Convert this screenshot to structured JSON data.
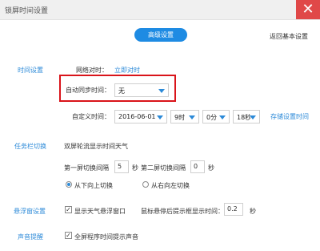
{
  "window": {
    "title": "锁屏时间设置",
    "close_label": "✕"
  },
  "header": {
    "advanced_button": "高级设置",
    "back_link": "返回基本设置"
  },
  "time_settings": {
    "section_label": "时间设置",
    "network_sync_label": "网络对时：",
    "sync_now_link": "立即对时",
    "auto_sync_label": "自动同步时间：",
    "auto_sync_value": "无",
    "custom_time_label": "自定义时间：",
    "date_value": "2016-06-01",
    "hour_value": "9时",
    "minute_value": "0分",
    "second_value": "18秒",
    "apply_link": "存储设置时间"
  },
  "task_switch": {
    "section_label": "任务栏切换",
    "mode_label": "双屏轮流显示时间天气",
    "first_screen_label": "第一屏切换间隔",
    "first_screen_value": "5",
    "seconds_label": "秒",
    "second_screen_label": "第二屏切换间隔",
    "second_screen_value": "0",
    "seconds_label2": "秒",
    "option_bottom": "从下向上切换",
    "option_right": "从右向左切换"
  },
  "float_settings": {
    "section_label": "悬浮窗设置",
    "show_weather_label": "显示天气悬浮窗口",
    "hide_delay_label": "鼠标悬停后提示框显示时间：",
    "hide_delay_value": "0.2",
    "seconds_label": "秒"
  },
  "sound_alert": {
    "section_label": "声音提醒",
    "hourly_chime_label": "全屏程序时间提示声音"
  }
}
